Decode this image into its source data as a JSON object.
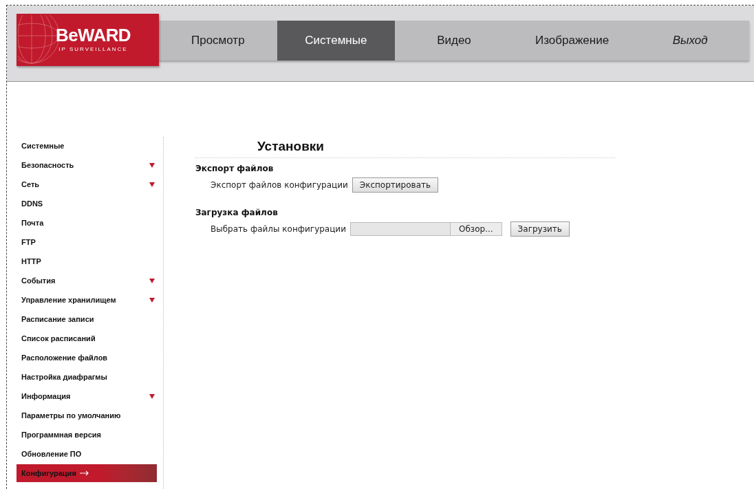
{
  "logo": {
    "brand": "BeWARD",
    "tagline": "IP SURVEILLANCE"
  },
  "nav_tabs": [
    {
      "label": "Просмотр",
      "selected": false,
      "kind": "page"
    },
    {
      "label": "Системные",
      "selected": true,
      "kind": "page"
    },
    {
      "label": "Видео",
      "selected": false,
      "kind": "page"
    },
    {
      "label": "Изображение",
      "selected": false,
      "kind": "page"
    },
    {
      "label": "Выход",
      "selected": false,
      "kind": "exit"
    }
  ],
  "sidebar": {
    "items": [
      {
        "label": "Системные",
        "has_submenu": false,
        "selected": false
      },
      {
        "label": "Безопасность",
        "has_submenu": true,
        "selected": false
      },
      {
        "label": "Сеть",
        "has_submenu": true,
        "selected": false
      },
      {
        "label": "DDNS",
        "has_submenu": false,
        "selected": false
      },
      {
        "label": "Почта",
        "has_submenu": false,
        "selected": false
      },
      {
        "label": "FTP",
        "has_submenu": false,
        "selected": false
      },
      {
        "label": "HTTP",
        "has_submenu": false,
        "selected": false
      },
      {
        "label": "События",
        "has_submenu": true,
        "selected": false
      },
      {
        "label": "Управление хранилищем",
        "has_submenu": true,
        "selected": false
      },
      {
        "label": "Расписание записи",
        "has_submenu": false,
        "selected": false
      },
      {
        "label": "Список расписаний",
        "has_submenu": false,
        "selected": false
      },
      {
        "label": "Расположение файлов",
        "has_submenu": false,
        "selected": false
      },
      {
        "label": "Настройка диафрагмы",
        "has_submenu": false,
        "selected": false
      },
      {
        "label": "Информация",
        "has_submenu": true,
        "selected": false
      },
      {
        "label": "Параметры по умолчанию",
        "has_submenu": false,
        "selected": false
      },
      {
        "label": "Программная версия",
        "has_submenu": false,
        "selected": false
      },
      {
        "label": "Обновление ПО",
        "has_submenu": false,
        "selected": false
      },
      {
        "label": "Конфигурация",
        "has_submenu": false,
        "selected": true
      }
    ]
  },
  "content": {
    "title": "Установки",
    "sections": [
      {
        "heading": "Экспорт файлов",
        "kind": "export",
        "label": "Экспорт файлов конфигурации",
        "button": "Экспортировать"
      },
      {
        "heading": "Загрузка файлов",
        "kind": "upload",
        "label": "Выбрать файлы конфигурации",
        "browse_button": "Обзор...",
        "button": "Загрузить"
      }
    ]
  }
}
